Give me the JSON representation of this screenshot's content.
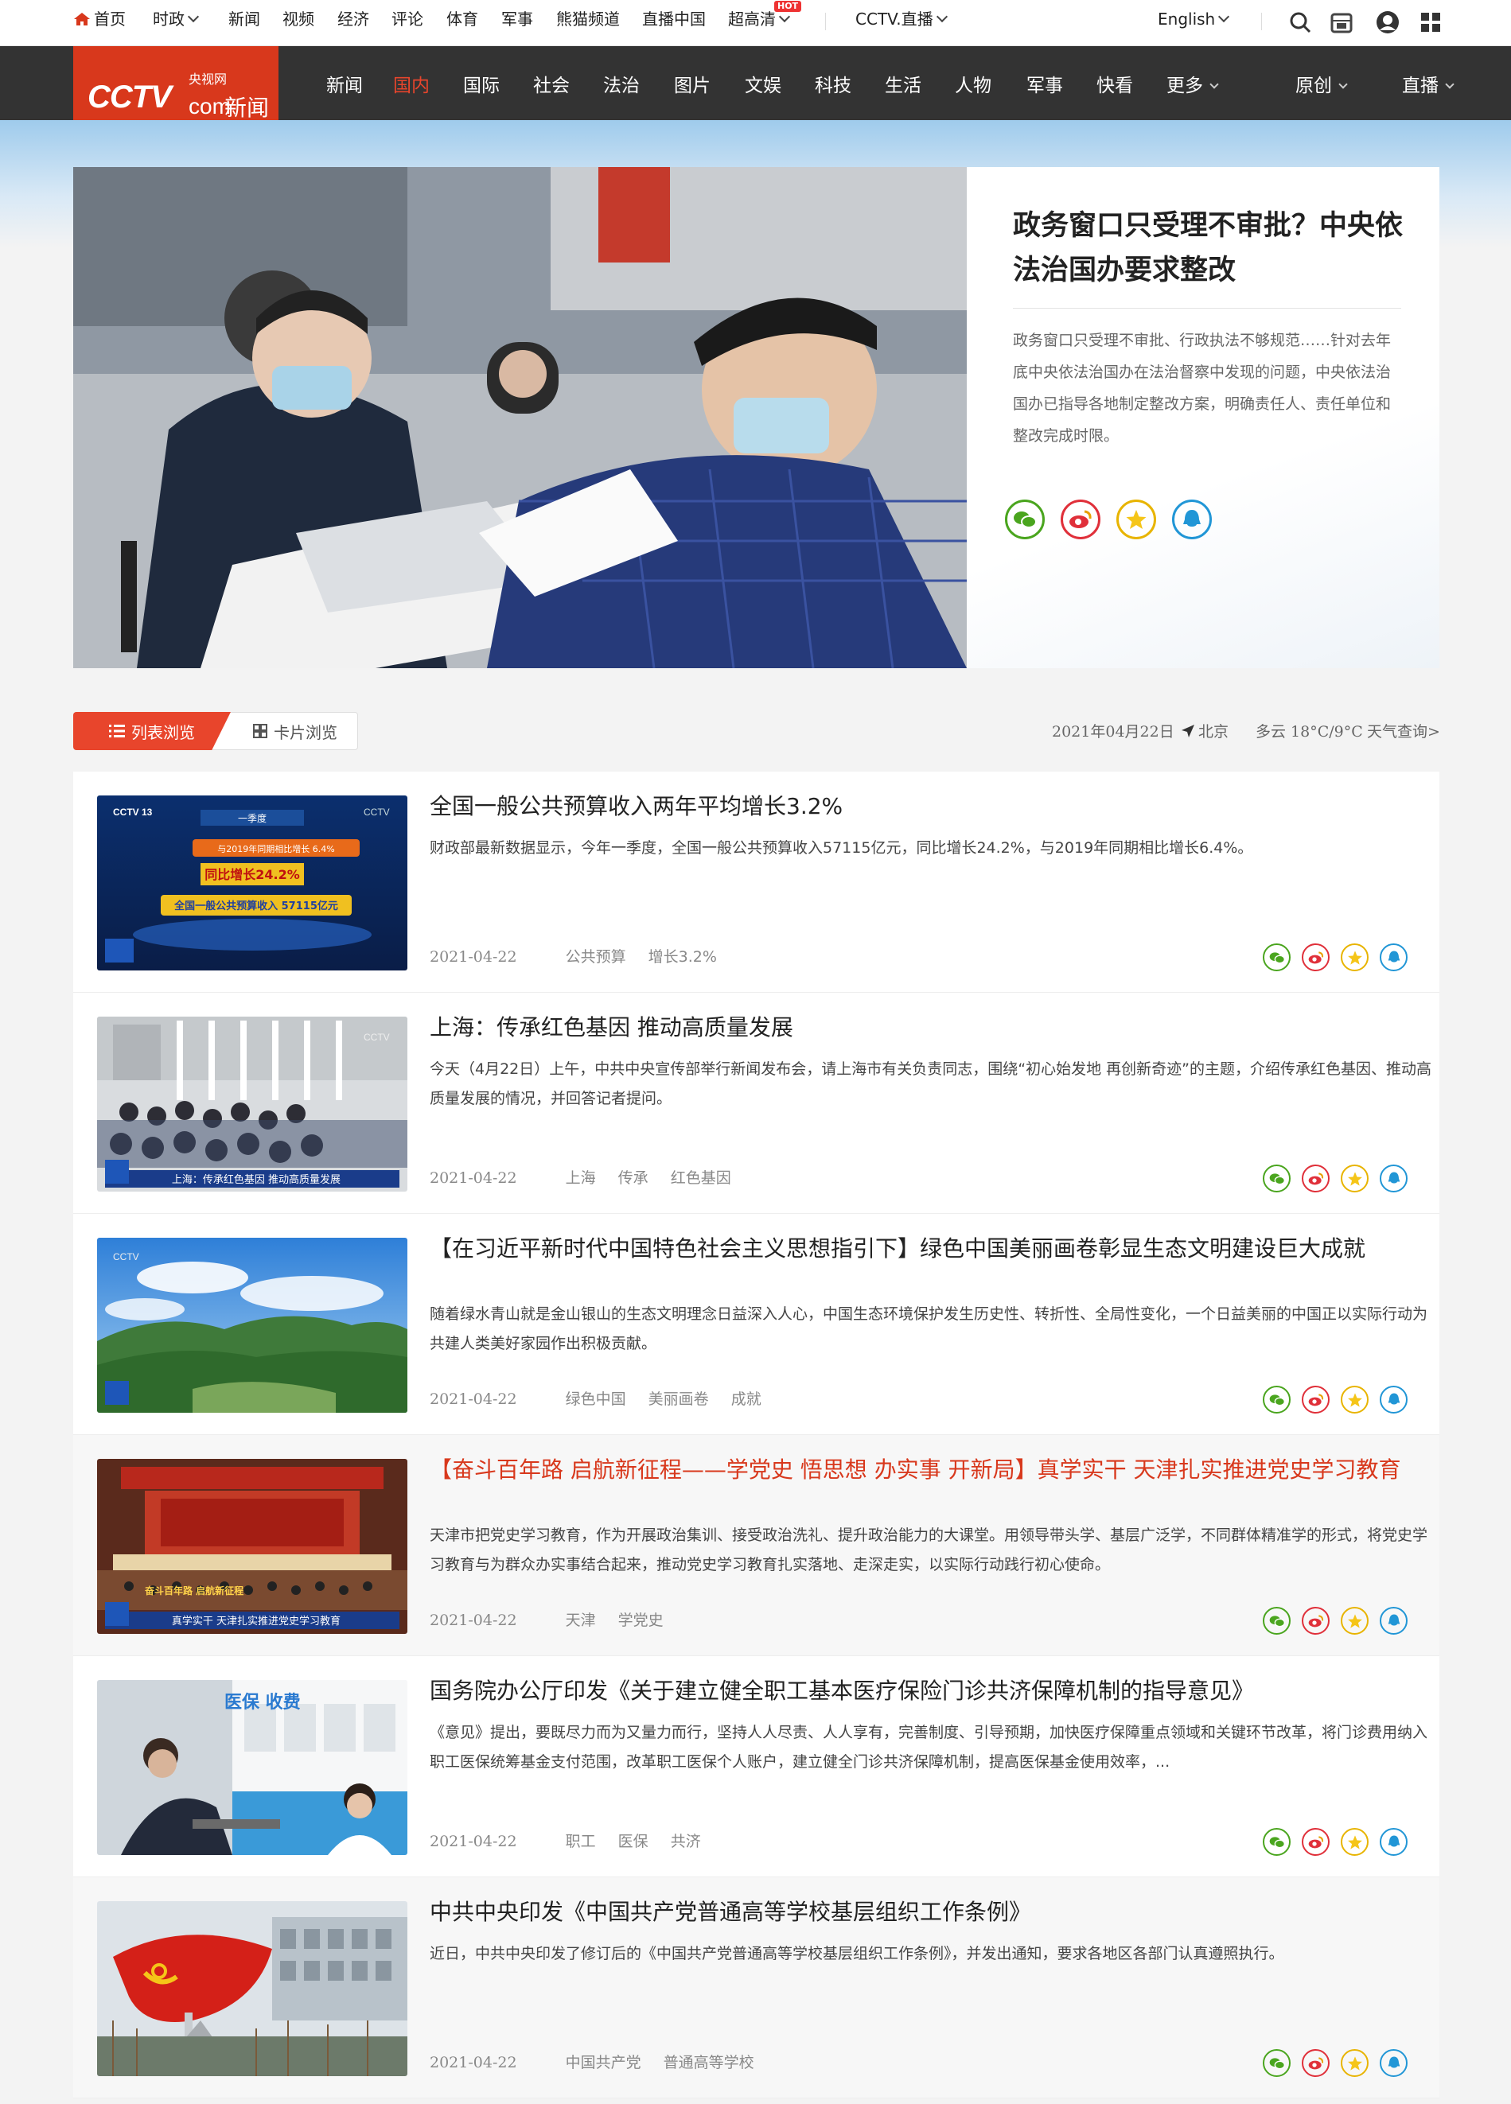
{
  "topbar": {
    "items": [
      "首页",
      "时政",
      "新闻",
      "视频",
      "经济",
      "评论",
      "体育",
      "军事",
      "熊猫频道",
      "直播中国",
      "超高清",
      "CCTV.直播",
      "English"
    ],
    "hot_badge": "HOT"
  },
  "logo": {
    "cctv": "CCTV",
    "com": "com",
    "yang": "央视网",
    "xinwen": "新闻"
  },
  "nav": {
    "items": [
      "新闻",
      "国内",
      "国际",
      "社会",
      "法治",
      "图片",
      "文娱",
      "科技",
      "生活",
      "人物",
      "军事",
      "快看",
      "更多",
      "原创",
      "直播"
    ],
    "active": "国内"
  },
  "hero": {
    "title": "政务窗口只受理不审批？中央依法治国办要求整改",
    "desc": "政务窗口只受理不审批、行政执法不够规范……针对去年底中央依法治国办在法治督察中发现的问题，中央依法治国办已指导各地制定整改方案，明确责任人、责任单位和整改完成时限。"
  },
  "view_tabs": {
    "list": "列表浏览",
    "card": "卡片浏览"
  },
  "weather": {
    "date": "2021年04月22日",
    "city": "北京",
    "condition": "多云 18°C/9°C",
    "link": "天气查询>"
  },
  "articles": [
    {
      "title": "全国一般公共预算收入两年平均增长3.2%",
      "desc": "财政部最新数据显示，今年一季度，全国一般公共预算收入57115亿元，同比增长24.2%，与2019年同期相比增长6.4%。",
      "date": "2021-04-22",
      "tags": [
        "公共预算",
        "增长3.2%"
      ],
      "thumb_text": [
        "同比增长24.2%",
        "全国一般公共预算收入 57115亿元",
        "与2019年同期相比增长 6.4%",
        "一季度"
      ]
    },
    {
      "title": "上海：传承红色基因 推动高质量发展",
      "desc": "今天（4月22日）上午，中共中央宣传部举行新闻发布会，请上海市有关负责同志，围绕“初心始发地 再创新奇迹”的主题，介绍传承红色基因、推动高质量发展的情况，并回答记者提问。",
      "date": "2021-04-22",
      "tags": [
        "上海",
        "传承",
        "红色基因"
      ],
      "thumb_text": [
        "上海：传承红色基因 推动高质量发展"
      ]
    },
    {
      "title": "【在习近平新时代中国特色社会主义思想指引下】绿色中国美丽画卷彰显生态文明建设巨大成就",
      "desc": "随着绿水青山就是金山银山的生态文明理念日益深入人心，中国生态环境保护发生历史性、转折性、全局性变化，一个日益美丽的中国正以实际行动为共建人类美好家园作出积极贡献。",
      "date": "2021-04-22",
      "tags": [
        "绿色中国",
        "美丽画卷",
        "成就"
      ],
      "thumb_text": []
    },
    {
      "title": "【奋斗百年路 启航新征程——学党史 悟思想 办实事 开新局】真学实干 天津扎实推进党史学习教育",
      "desc": "天津市把党史学习教育，作为开展政治集训、接受政治洗礼、提升政治能力的大课堂。用领导带头学、基层广泛学，不同群体精准学的形式，将党史学习教育与为群众办实事结合起来，推动党史学习教育扎实落地、走深走实，以实际行动践行初心使命。",
      "date": "2021-04-22",
      "tags": [
        "天津",
        "学党史"
      ],
      "thumb_text": [
        "真学实干 天津扎实推进党史学习教育",
        "奋斗百年路 启航新征程"
      ]
    },
    {
      "title": "国务院办公厅印发《关于建立健全职工基本医疗保险门诊共济保障机制的指导意见》",
      "desc": "《意见》提出，要既尽力而为又量力而行，坚持人人尽责、人人享有，完善制度、引导预期，加快医疗保障重点领域和关键环节改革，将门诊费用纳入职工医保统筹基金支付范围，改革职工医保个人账户，建立健全门诊共济保障机制，提高医保基金使用效率，...",
      "date": "2021-04-22",
      "tags": [
        "职工",
        "医保",
        "共济"
      ],
      "thumb_text": [
        "医保 收费"
      ]
    },
    {
      "title": "中共中央印发《中国共产党普通高等学校基层组织工作条例》",
      "desc": "近日，中共中央印发了修订后的《中国共产党普通高等学校基层组织工作条例》，并发出通知，要求各地区各部门认真遵照执行。",
      "date": "2021-04-22",
      "tags": [
        "中国共产党",
        "普通高等学校"
      ],
      "thumb_text": []
    }
  ],
  "colors": {
    "brand": "#d8381c",
    "nav_bg": "#333333",
    "wechat": "#4aa51e",
    "weibo": "#e0303a",
    "fav": "#e8b400",
    "qq": "#2196d6"
  },
  "icons": [
    "home-icon",
    "chevron-down-icon",
    "search-icon",
    "app-icon",
    "user-icon",
    "grid-icon",
    "wechat-icon",
    "weibo-icon",
    "favorite-icon",
    "qq-icon",
    "location-icon",
    "list-icon",
    "card-icon"
  ]
}
